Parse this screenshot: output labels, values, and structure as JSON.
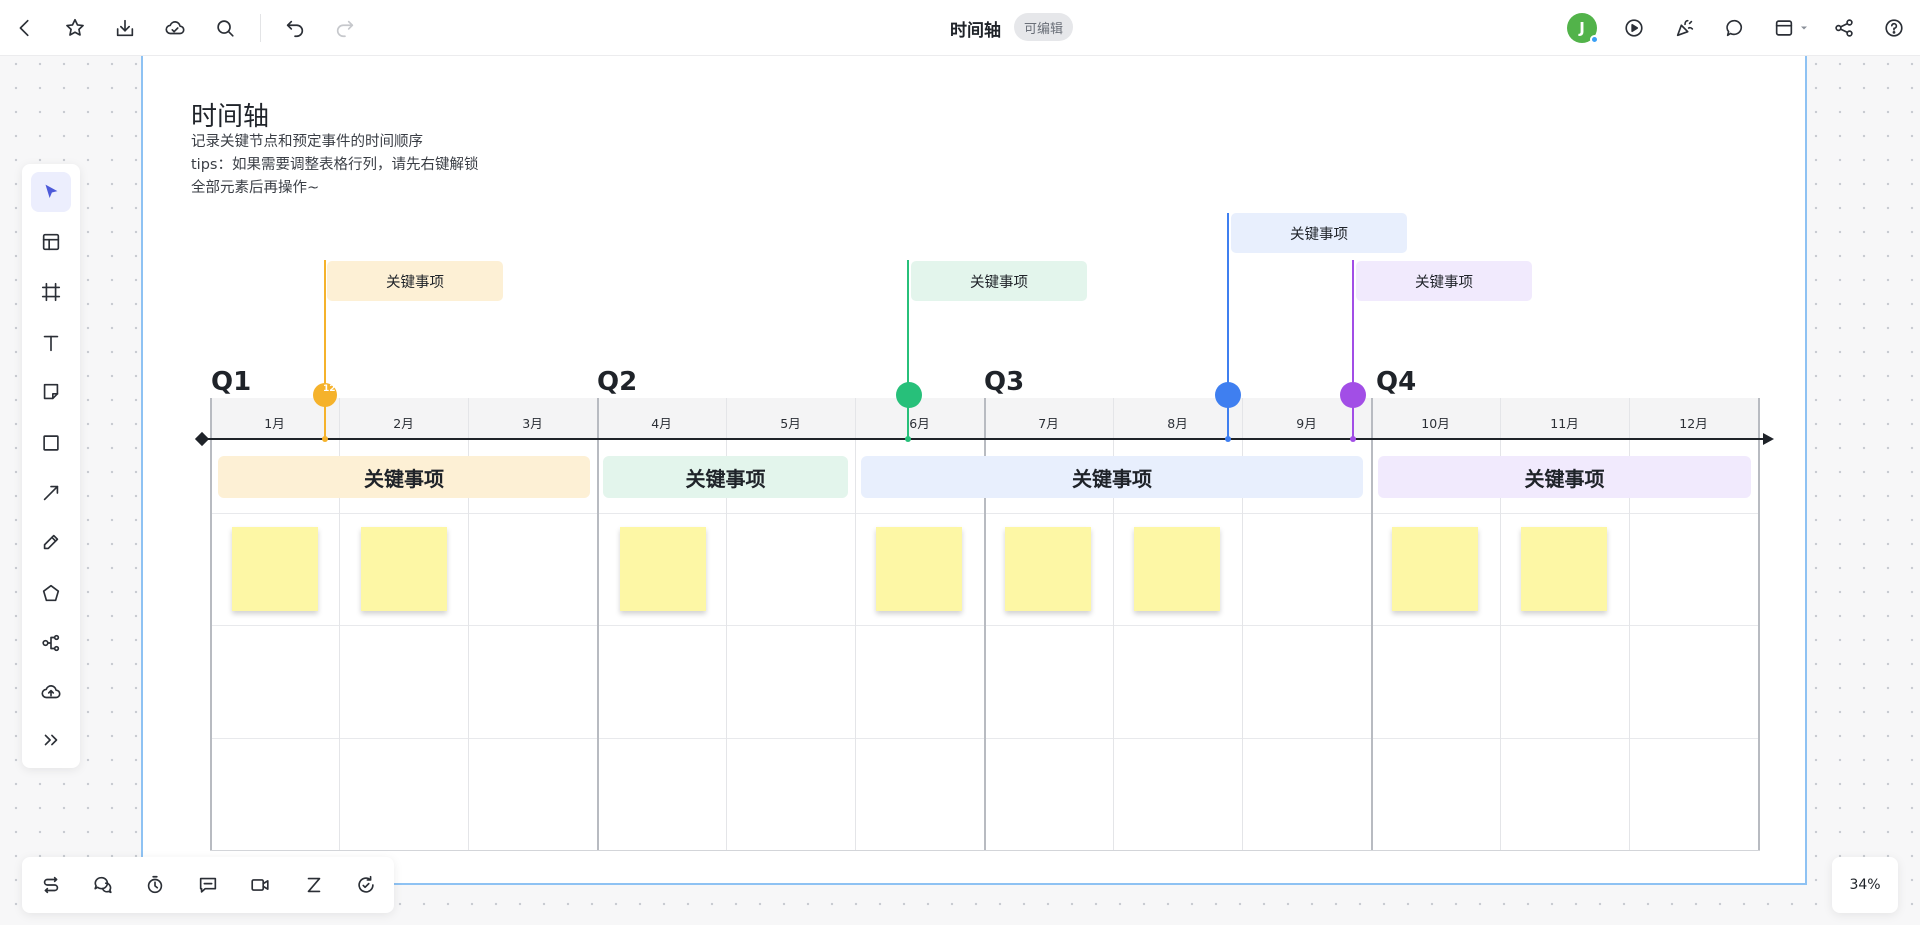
{
  "header": {
    "title": "时间轴",
    "badge": "可编辑",
    "avatar_letter": "J",
    "icons_left": [
      "back-icon",
      "star-icon",
      "download-icon",
      "cloud-icon",
      "search-icon",
      "undo-icon",
      "redo-icon"
    ],
    "icons_right": [
      "play-icon",
      "celebrate-icon",
      "comment-icon",
      "layout-icon",
      "share-icon",
      "help-icon"
    ]
  },
  "sheet": {
    "title": "时间轴",
    "desc_lines": [
      "记录关键节点和预定事件的时间顺序",
      "tips：如果需要调整表格行列，请先右键解锁",
      "全部元素后再操作~"
    ]
  },
  "quarters": [
    "Q1",
    "Q2",
    "Q3",
    "Q4"
  ],
  "months": [
    "1月",
    "2月",
    "3月",
    "4月",
    "5月",
    "6月",
    "7月",
    "8月",
    "9月",
    "10月",
    "11月",
    "12月"
  ],
  "bands": [
    {
      "label": "关键事项",
      "color": "#fdf0d5"
    },
    {
      "label": "关键事项",
      "color": "#e3f5ec"
    },
    {
      "label": "关键事项",
      "color": "#e8effd"
    },
    {
      "label": "关键事项",
      "color": "#f1eafd"
    }
  ],
  "milestones": [
    {
      "label": "关键事项",
      "color": "#f5b22b",
      "card_color": "#fdf0d5",
      "count": "12"
    },
    {
      "label": "关键事项",
      "color": "#27c07a",
      "card_color": "#e3f5ec"
    },
    {
      "label": "关键事项",
      "color": "#3f7ff0",
      "card_color": "#e8effd"
    },
    {
      "label": "关键事项",
      "color": "#a24ee6",
      "card_color": "#f1eafd"
    }
  ],
  "left_tools": [
    "select-icon",
    "template-icon",
    "frame-icon",
    "text-icon",
    "sticky-note-icon",
    "rectangle-icon",
    "line-icon",
    "pen-icon",
    "shape-icon",
    "mindmap-icon",
    "upload-icon",
    "more-icon"
  ],
  "bottom_tools": [
    "connector-icon",
    "chat-icon",
    "timer-icon",
    "message-icon",
    "video-icon",
    "sleep-icon",
    "history-icon"
  ],
  "zoom": "34%"
}
